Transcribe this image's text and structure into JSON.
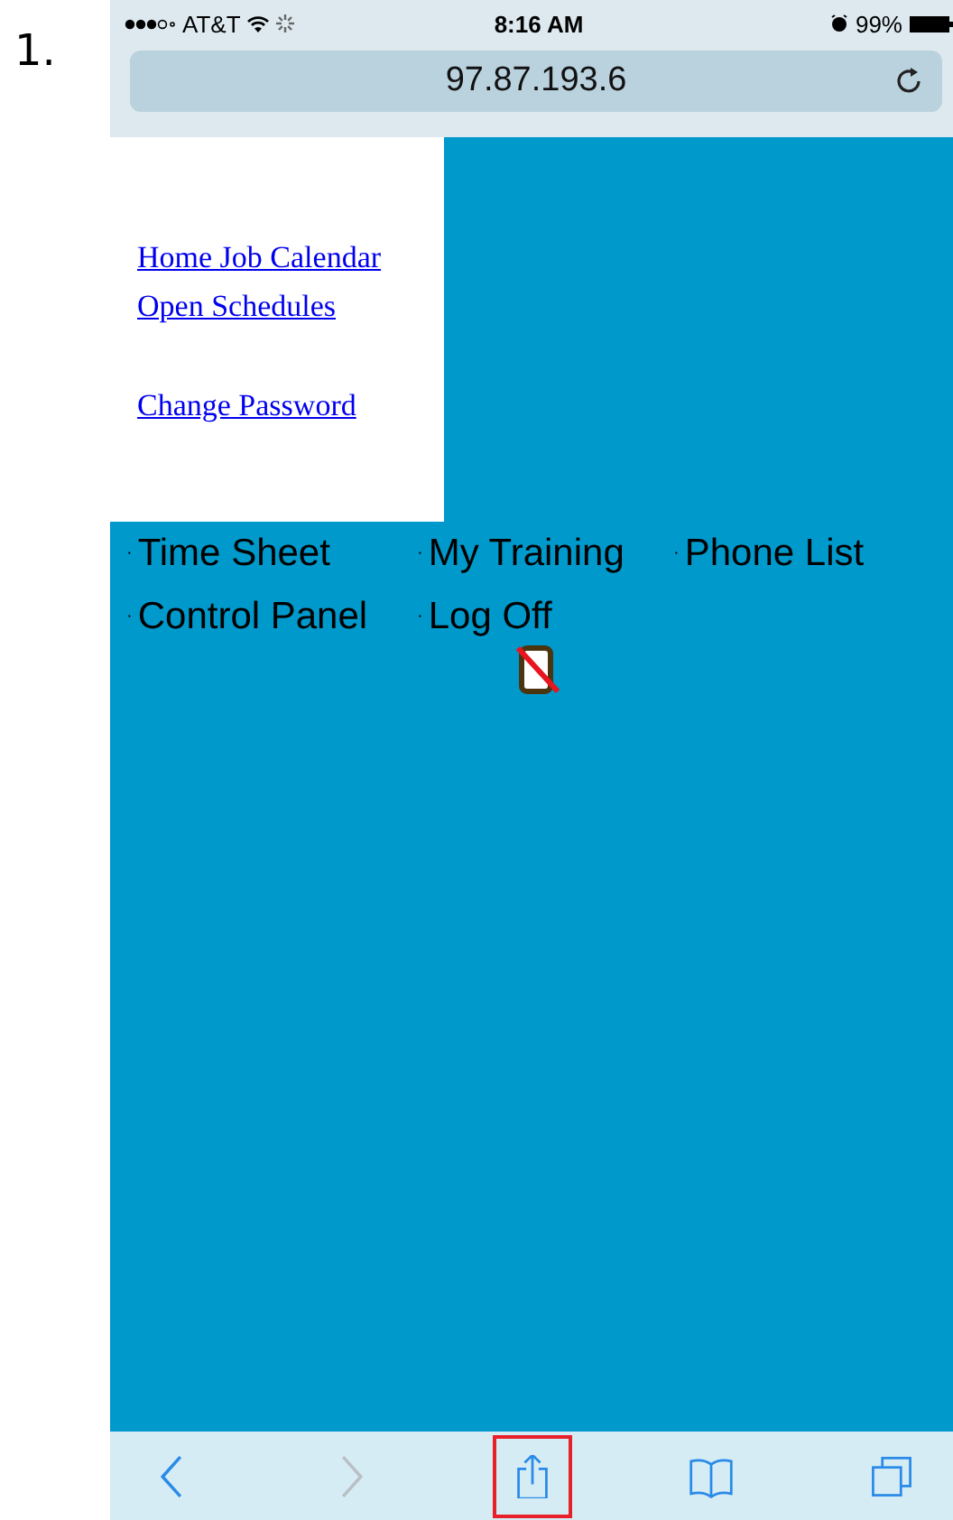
{
  "step_number": "1.",
  "status_bar": {
    "carrier": "AT&T",
    "time": "8:16 AM",
    "battery": "99%"
  },
  "address_bar": {
    "url": "97.87.193.6"
  },
  "link_groups": [
    {
      "links": [
        "Home Job Calendar",
        "Open Schedules"
      ]
    },
    {
      "links": [
        "Change Password"
      ]
    }
  ],
  "menu": [
    {
      "bullet": "·",
      "label": "Time Sheet"
    },
    {
      "bullet": "·",
      "label": "My Training"
    },
    {
      "bullet": "·",
      "label": "Phone List"
    },
    {
      "bullet": "·",
      "label": "Control Panel"
    },
    {
      "bullet": "·",
      "label": "Log Off"
    }
  ],
  "toolbar": [
    {
      "kind": "back",
      "disabled": false,
      "highlighted": false
    },
    {
      "kind": "forward",
      "disabled": true,
      "highlighted": false
    },
    {
      "kind": "share",
      "disabled": false,
      "highlighted": true
    },
    {
      "kind": "bookmarks",
      "disabled": false,
      "highlighted": false
    },
    {
      "kind": "tabs",
      "disabled": false,
      "highlighted": false
    }
  ]
}
